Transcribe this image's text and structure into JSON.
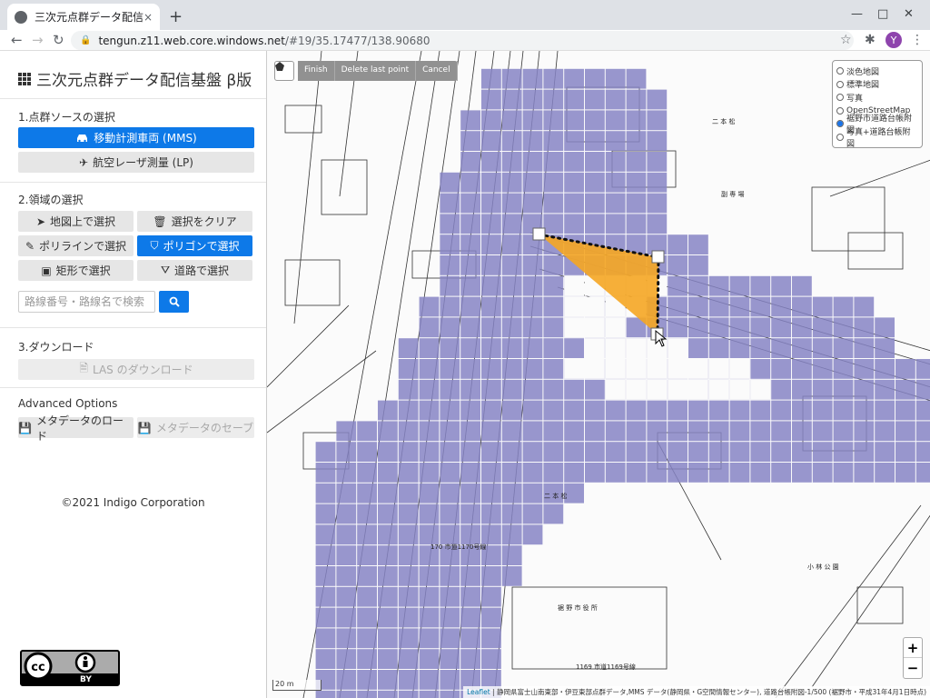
{
  "browser": {
    "tab_title": "三次元点群データ配信基盤 β版",
    "tab_close": "×",
    "new_tab": "+",
    "url_domain": "tengun.z11.web.core.windows.net",
    "url_path": "/#19/35.17477/138.90680",
    "avatar_letter": "Y"
  },
  "sidebar": {
    "title": "三次元点群データ配信基盤 β版",
    "section1": {
      "label": "1.点群ソースの選択",
      "mms_label": "移動計測車両 (MMS)",
      "lp_label": "航空レーザ測量 (LP)"
    },
    "section2": {
      "label": "2.領域の選択",
      "select_on_map": "地図上で選択",
      "clear_selection": "選択をクリア",
      "select_polyline": "ポリラインで選択",
      "select_polygon": "ポリゴンで選択",
      "select_rect": "矩形で選択",
      "select_road": "道路で選択",
      "search_placeholder": "路線番号・路線名で検索"
    },
    "section3": {
      "label": "3.ダウンロード",
      "download_las": "LAS のダウンロード"
    },
    "advanced": {
      "label": "Advanced Options",
      "load_metadata": "メタデータのロード",
      "save_metadata": "メタデータのセーブ"
    },
    "copyright": "©2021 Indigo Corporation",
    "cc_label": "BY"
  },
  "map": {
    "draw_actions": [
      "Finish",
      "Delete last point",
      "Cancel"
    ],
    "layers": [
      {
        "label": "淡色地図",
        "selected": false
      },
      {
        "label": "標準地図",
        "selected": false
      },
      {
        "label": "写真",
        "selected": false
      },
      {
        "label": "OpenStreetMap",
        "selected": false
      },
      {
        "label": "裾野市道路台帳附図",
        "selected": true
      },
      {
        "label": "写真+道路台帳附図",
        "selected": false
      }
    ],
    "zoom_in": "+",
    "zoom_out": "−",
    "scale_label": "20 m",
    "attribution_link": "Leaflet",
    "attribution_text": " | 静岡県富士山南東部・伊豆東部点群データ,MMS データ(静岡県・G空間情報センター), 道路台帳附図-1/500 (裾野市・平成31年4月1日時点)",
    "labels": {
      "nihonmatsu_1": "二 本 松",
      "nihonmatsu_2": "二 本 松",
      "shityakusho": "裾 野 市 役 所",
      "route_1169": "1169  市道1169号線",
      "route_1170": "170  市道1170号線",
      "koryuu": "副 専 場",
      "kouen": "小 林 公 園"
    },
    "colors": {
      "tile_fill": "#8684c4",
      "polygon_fill": "#f5a623"
    }
  }
}
